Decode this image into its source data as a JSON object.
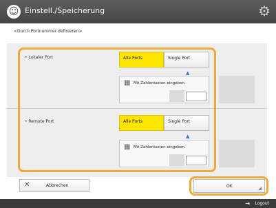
{
  "header": {
    "title": "Einstell./Speicherung",
    "app_icon": "user-circle-icon",
    "settings_icon": "gear-icon"
  },
  "subtitle": "<Durch Portnummer definieren>",
  "sections": [
    {
      "label": "Lokaler Port",
      "options": [
        "Alle Ports",
        "Single Port"
      ],
      "selected": "Alle Ports",
      "numeric_label": "Mit Zahlentasten eingeben.",
      "value": ""
    },
    {
      "label": "Remote Port",
      "options": [
        "Alle Ports",
        "Single Port"
      ],
      "selected": "Alle Ports",
      "numeric_label": "Mit Zahlentasten eingeben.",
      "value": ""
    }
  ],
  "buttons": {
    "cancel": "Abbrechen",
    "ok": "OK"
  },
  "footer": {
    "logout": "Logout"
  },
  "colors": {
    "highlight": "#f2a93b",
    "selected": "#ffe400",
    "titlebar": "#4e4e4e"
  }
}
